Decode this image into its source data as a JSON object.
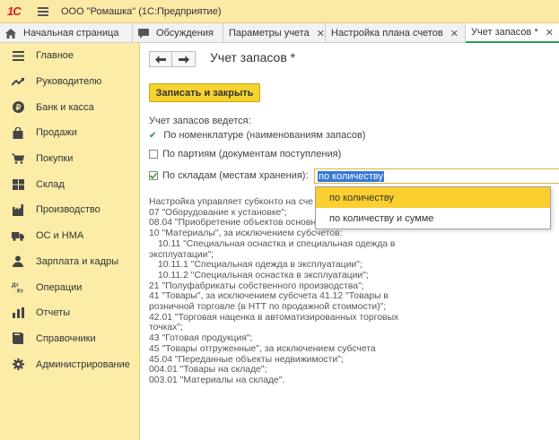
{
  "window": {
    "logo": "1С",
    "title": "ООО \"Ромашка\"  (1С:Предприятие)"
  },
  "tabs": [
    {
      "label": "Начальная страница",
      "icon": "home-icon",
      "closable": false,
      "active": false
    },
    {
      "label": "Обсуждения",
      "icon": "chat-icon",
      "closable": false,
      "active": false
    },
    {
      "label": "Параметры учета",
      "closable": true,
      "active": false
    },
    {
      "label": "Настройка плана счетов",
      "closable": true,
      "active": false
    },
    {
      "label": "Учет запасов *",
      "closable": true,
      "active": true
    }
  ],
  "sidebar": {
    "items": [
      {
        "label": "Главное",
        "icon": "menu-icon"
      },
      {
        "label": "Руководителю",
        "icon": "trend-icon"
      },
      {
        "label": "Банк и касса",
        "icon": "coin-icon"
      },
      {
        "label": "Продажи",
        "icon": "bag-icon"
      },
      {
        "label": "Покупки",
        "icon": "cart-icon"
      },
      {
        "label": "Склад",
        "icon": "warehouse-icon"
      },
      {
        "label": "Производство",
        "icon": "factory-icon"
      },
      {
        "label": "ОС и НМА",
        "icon": "truck-icon"
      },
      {
        "label": "Зарплата и кадры",
        "icon": "person-icon"
      },
      {
        "label": "Операции",
        "icon": "dt-kt-icon"
      },
      {
        "label": "Отчеты",
        "icon": "report-icon"
      },
      {
        "label": "Справочники",
        "icon": "book-icon"
      },
      {
        "label": "Администрирование",
        "icon": "gear-icon"
      }
    ]
  },
  "form": {
    "title": "Учет запасов *",
    "save_label": "Записать и закрыть",
    "stock_accounting_label": "Учет запасов ведется:",
    "by_nomenclature_label": "По номенклатуре (наименованиям запасов)",
    "by_batches_label": "По партиям (документам поступления)",
    "by_batches_checked": false,
    "by_warehouses_label": "По складам (местам хранения):",
    "by_warehouses_checked": true,
    "warehouse_mode_value": "по количеству",
    "warehouse_mode_options": [
      "по количеству",
      "по количеству и сумме"
    ],
    "warehouse_mode_highlighted": "по количеству",
    "setup_lines": [
      "Настройка управляет субконто на сче",
      "07 \"Оборудование к установке\";",
      "08.04 \"Приобретение объектов основн",
      "10 \"Материалы\", за исключением субсчетов:",
      "10.11 \"Специальная оснастка и специальная одежда в",
      "эксплуатации\";",
      "10.11.1 \"Специальная одежда в эксплуатации\";",
      "10.11.2 \"Специальная оснастка в эксплуатации\";",
      "21 \"Полуфабрикаты собственного производства\";",
      "41 \"Товары\", за исключением субсчета 41.12 \"Товары в",
      "розничной торговле (в НТТ по продажной стоимости)\";",
      "42.01 \"Торговая наценка в автоматизированных торговых",
      "точках\";",
      "43 \"Готовая продукция\";",
      "45 \"Товары отгруженные\", за исключением субсчета",
      "45.04 \"Переданные объекты недвижимости\";",
      "004.01 \"Товары на складе\";",
      "003.01 \"Материалы на складе\"."
    ]
  },
  "colors": {
    "logo_red": "#d21f1f",
    "sidebar_bg": "#fbeda8",
    "titlebar_bg": "#fbe9a6",
    "primary_button": "#f6d32f",
    "active_tab_accent": "#2aa05a",
    "selection_blue": "#3579d6",
    "dropdown_highlight": "#fbcf2f"
  }
}
